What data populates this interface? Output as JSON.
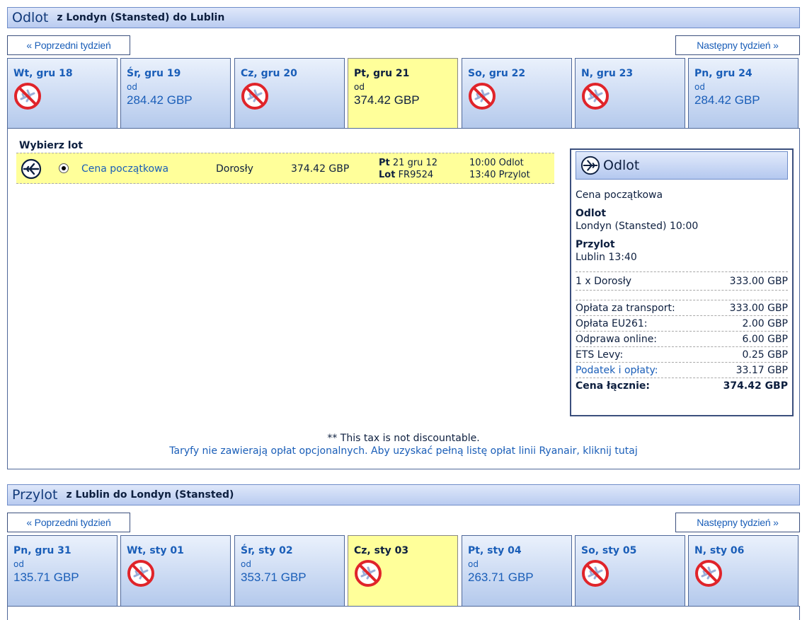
{
  "outbound": {
    "title": "Odlot",
    "route": "z Londyn (Stansted) do Lublin",
    "prev_week": "« Poprzedni tydzień",
    "next_week": "Następny tydzień »",
    "days": [
      {
        "date": "Wt, gru 18",
        "available": false
      },
      {
        "date": "Śr, gru 19",
        "available": true,
        "od": "od",
        "price": "284.42 GBP"
      },
      {
        "date": "Cz, gru 20",
        "available": false
      },
      {
        "date": "Pt, gru 21",
        "available": true,
        "od": "od",
        "price": "374.42 GBP",
        "selected": true
      },
      {
        "date": "So, gru 22",
        "available": false
      },
      {
        "date": "N, gru 23",
        "available": false
      },
      {
        "date": "Pn, gru 24",
        "available": true,
        "od": "od",
        "price": "284.42 GBP"
      }
    ],
    "choose_label": "Wybierz lot",
    "flight": {
      "fare": "Cena początkowa",
      "passenger": "Dorosły",
      "price": "374.42 GBP",
      "day_label": "Pt",
      "date": "21 gru 12",
      "flight_label": "Lot",
      "flight_no": "FR9524",
      "dep": "10:00 Odlot",
      "arr": "13:40 Przylot"
    },
    "summary": {
      "title": "Odlot",
      "fare": "Cena początkowa",
      "dep_label": "Odlot",
      "dep_value": "Londyn (Stansted) 10:00",
      "arr_label": "Przylot",
      "arr_value": "Lublin 13:40",
      "pax_line": "1 x Dorosły",
      "pax_amount": "333.00 GBP",
      "fees": [
        {
          "label": "Opłata za transport:",
          "amount": "333.00 GBP"
        },
        {
          "label": "Opłata EU261:",
          "amount": "2.00 GBP"
        },
        {
          "label": "Odprawa online:",
          "amount": "6.00 GBP"
        },
        {
          "label": "ETS Levy:",
          "amount": "0.25 GBP"
        },
        {
          "label": "Podatek i opłaty:",
          "amount": "33.17 GBP",
          "link": true
        }
      ],
      "total_label": "Cena łącznie:",
      "total_amount": "374.42 GBP"
    },
    "tax_note": "** This tax is not discountable.",
    "fare_note": "Taryfy nie zawierają opłat opcjonalnych. Aby uzyskać pełną listę opłat linii Ryanair, kliknij tutaj"
  },
  "inbound": {
    "title": "Przylot",
    "route": "z Lublin do Londyn (Stansted)",
    "prev_week": "« Poprzedni tydzień",
    "next_week": "Następny tydzień »",
    "days": [
      {
        "date": "Pn, gru 31",
        "available": true,
        "od": "od",
        "price": "135.71 GBP"
      },
      {
        "date": "Wt, sty 01",
        "available": false
      },
      {
        "date": "Śr, sty 02",
        "available": true,
        "od": "od",
        "price": "353.71 GBP"
      },
      {
        "date": "Cz, sty 03",
        "available": false,
        "selected": true
      },
      {
        "date": "Pt, sty 04",
        "available": true,
        "od": "od",
        "price": "263.71 GBP"
      },
      {
        "date": "So, sty 05",
        "available": false
      },
      {
        "date": "N, sty 06",
        "available": false
      }
    ]
  },
  "colors": {
    "link": "#1a5eb8",
    "selected_tab": "#ffff9a",
    "no_flight": "#e0242a"
  },
  "icons": {
    "no_flight": "no-flight-icon",
    "plane": "airplane-icon"
  }
}
